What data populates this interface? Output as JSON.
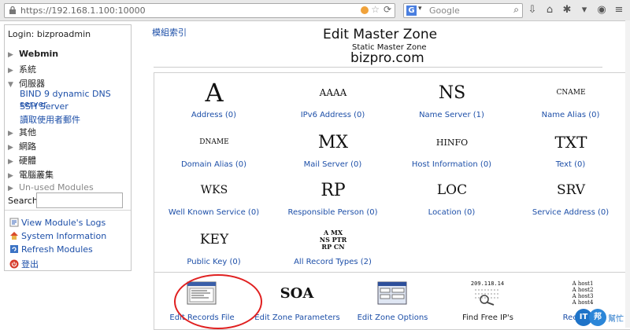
{
  "browser": {
    "url": "https://192.168.1.100:10000",
    "search_placeholder": "Google",
    "search_engine_icon": "google-icon"
  },
  "sidebar": {
    "login": "Login: bizproadmin",
    "items": [
      {
        "label": "Webmin",
        "expanded": false
      },
      {
        "label": "系統",
        "expanded": false
      },
      {
        "label": "伺服器",
        "expanded": true
      },
      {
        "label": "其他",
        "expanded": false
      },
      {
        "label": "網路",
        "expanded": false
      },
      {
        "label": "硬體",
        "expanded": false
      },
      {
        "label": "電腦叢集",
        "expanded": false
      },
      {
        "label": "Un-used Modules",
        "expanded": false
      }
    ],
    "server_links": [
      "BIND 9 dynamic DNS server",
      "SSH Server",
      "讀取使用者郵件"
    ],
    "search_label": "Search:",
    "search_value": "",
    "actions": [
      {
        "label": "View Module's Logs",
        "icon": "logs-icon"
      },
      {
        "label": "System Information",
        "icon": "home-icon"
      },
      {
        "label": "Refresh Modules",
        "icon": "refresh-icon"
      },
      {
        "label": "登出",
        "icon": "logout-icon"
      }
    ]
  },
  "main": {
    "module_index": "模組索引",
    "title": "Edit Master Zone",
    "subtitle": "Static Master Zone",
    "zone": "bizpro.com",
    "records": [
      {
        "glyph": "A",
        "label": "Address (0)"
      },
      {
        "glyph": "AAAA",
        "label": "IPv6 Address (0)"
      },
      {
        "glyph": "NS",
        "label": "Name Server (1)"
      },
      {
        "glyph": "CNAME",
        "label": "Name Alias (0)"
      },
      {
        "glyph": "DNAME",
        "label": "Domain Alias (0)"
      },
      {
        "glyph": "MX",
        "label": "Mail Server (0)"
      },
      {
        "glyph": "HINFO",
        "label": "Host Information (0)"
      },
      {
        "glyph": "TXT",
        "label": "Text (0)"
      },
      {
        "glyph": "WKS",
        "label": "Well Known Service (0)"
      },
      {
        "glyph": "RP",
        "label": "Responsible Person (0)"
      },
      {
        "glyph": "LOC",
        "label": "Location (0)"
      },
      {
        "glyph": "SRV",
        "label": "Service Address (0)"
      },
      {
        "glyph": "KEY",
        "label": "Public Key (0)"
      },
      {
        "glyph": "A MX\nNS PTR\nRP CN",
        "label": "All Record Types (2)"
      }
    ],
    "tools": [
      {
        "icon": "records-file-icon",
        "label": "Edit Records File",
        "highlighted": true
      },
      {
        "icon": "soa-icon",
        "glyph": "SOA",
        "label": "Edit Zone Parameters"
      },
      {
        "icon": "zone-options-icon",
        "label": "Edit Zone Options"
      },
      {
        "icon": "free-ip-icon",
        "glyph": "209.118.14",
        "label": "Find Free IP's"
      },
      {
        "icon": "record-generator-icon",
        "glyph": "A host1\nA host2\nA host3\nA host4",
        "label": "Record Ge"
      }
    ]
  },
  "watermark": {
    "text": "幫忙",
    "badge1": "IT",
    "badge2": "邦"
  },
  "colors": {
    "link": "#1d4fa8",
    "highlight_circle": "#e02020"
  }
}
